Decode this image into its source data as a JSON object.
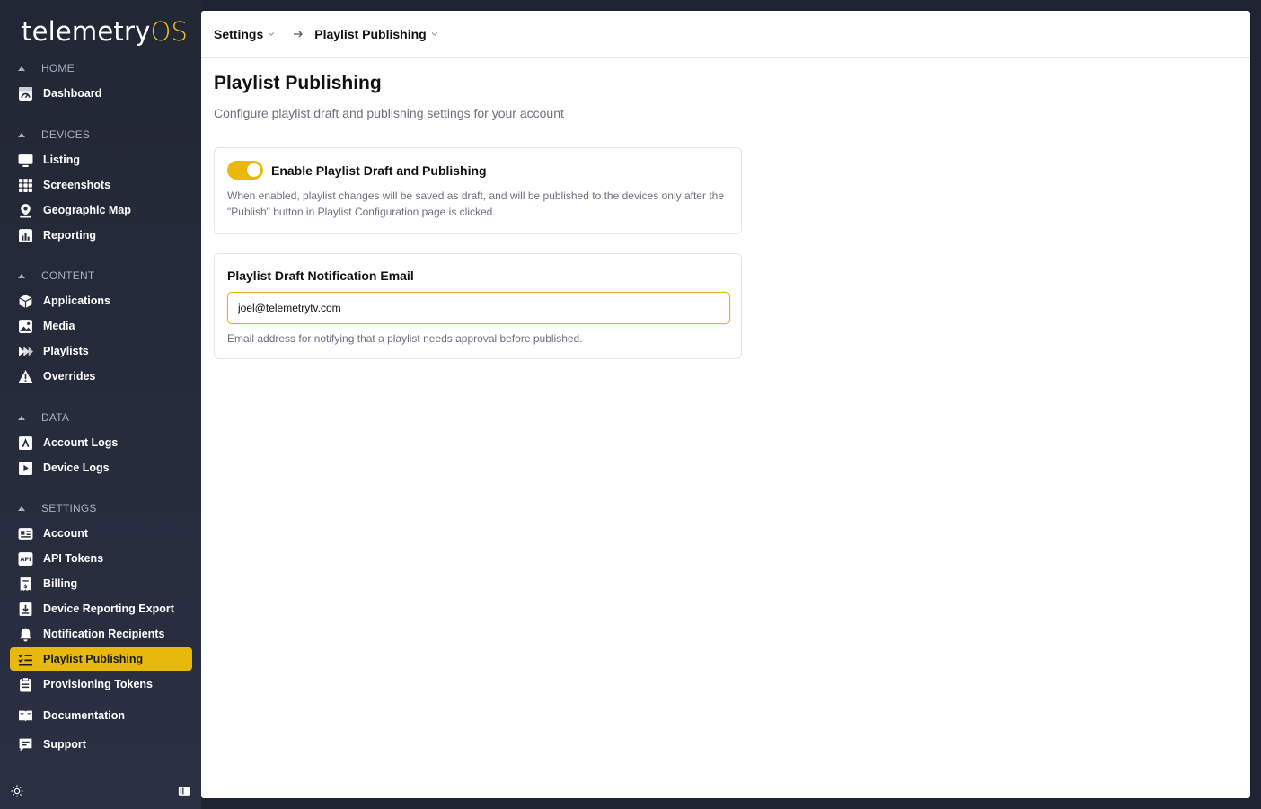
{
  "logo": {
    "main": "telemetry",
    "accent": "OS"
  },
  "sidebar": {
    "sections": {
      "home": "HOME",
      "devices": "DEVICES",
      "content": "CONTENT",
      "data": "DATA",
      "settings": "SETTINGS"
    },
    "items": {
      "dashboard": "Dashboard",
      "listing": "Listing",
      "screenshots": "Screenshots",
      "geographic_map": "Geographic Map",
      "reporting": "Reporting",
      "applications": "Applications",
      "media": "Media",
      "playlists": "Playlists",
      "overrides": "Overrides",
      "account_logs": "Account Logs",
      "device_logs": "Device Logs",
      "account": "Account",
      "api_tokens": "API Tokens",
      "billing": "Billing",
      "device_reporting_export": "Device Reporting Export",
      "notification_recipients": "Notification Recipients",
      "playlist_publishing": "Playlist Publishing",
      "provisioning_tokens": "Provisioning Tokens",
      "documentation": "Documentation",
      "support": "Support"
    },
    "active": "playlist_publishing"
  },
  "breadcrumb": {
    "parent": "Settings",
    "current": "Playlist Publishing"
  },
  "page": {
    "title": "Playlist Publishing",
    "subtitle": "Configure playlist draft and publishing settings for your account"
  },
  "publishing_card": {
    "toggle_label": "Enable Playlist Draft and Publishing",
    "toggle_on": true,
    "description": "When enabled, playlist changes will be saved as draft, and will be published to the devices only after the \"Publish\" button in Playlist Configuration page is clicked."
  },
  "email_card": {
    "label": "Playlist Draft Notification Email",
    "value": "joel@telemetrytv.com",
    "help": "Email address for notifying that a playlist needs approval before published."
  },
  "colors": {
    "accent": "#e8b90c",
    "sidebar_bg": "#222735"
  }
}
